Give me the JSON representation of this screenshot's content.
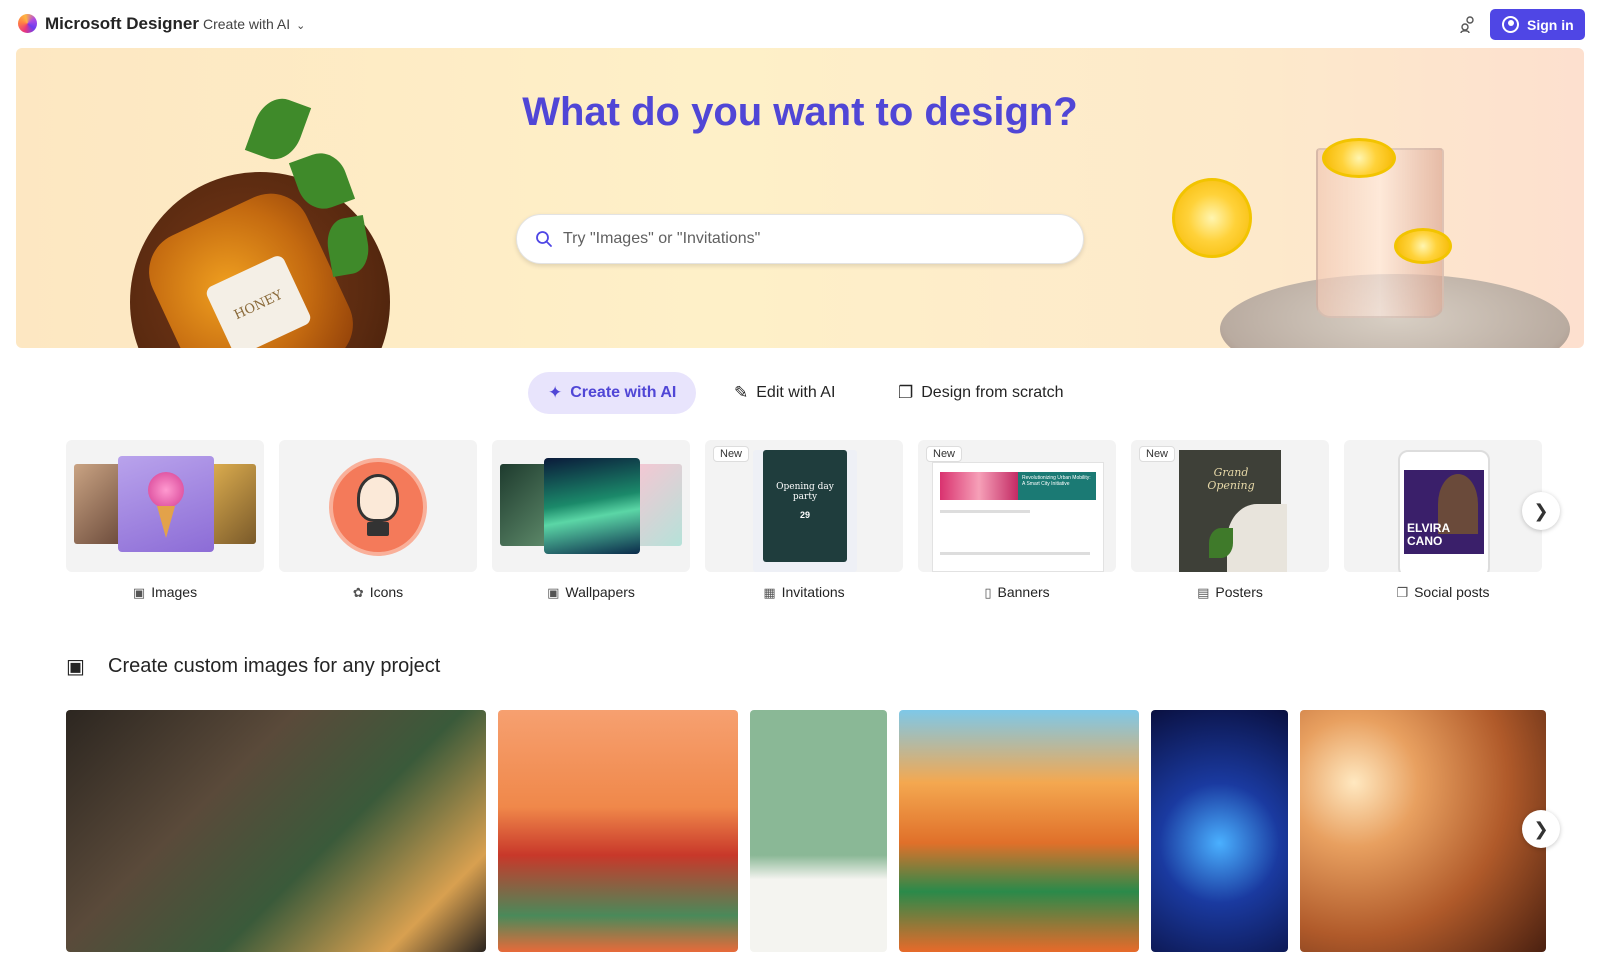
{
  "header": {
    "brand": "Microsoft Designer",
    "create_menu_label": "Create with AI",
    "sign_in_label": "Sign in",
    "accent_color": "#4f46e5"
  },
  "hero": {
    "title": "What do you want to design?",
    "search_placeholder": "Try \"Images\" or \"Invitations\"",
    "honey_label": "HONEY"
  },
  "modes": [
    {
      "label": "Create with AI",
      "active": true
    },
    {
      "label": "Edit with AI",
      "active": false
    },
    {
      "label": "Design from scratch",
      "active": false
    }
  ],
  "categories": [
    {
      "label": "Images",
      "badge": ""
    },
    {
      "label": "Icons",
      "badge": ""
    },
    {
      "label": "Wallpapers",
      "badge": ""
    },
    {
      "label": "Invitations",
      "badge": "New"
    },
    {
      "label": "Banners",
      "badge": "New"
    },
    {
      "label": "Posters",
      "badge": "New"
    },
    {
      "label": "Social posts",
      "badge": ""
    }
  ],
  "card_text": {
    "invitation_title": "Opening day party",
    "invitation_date": "29",
    "banner_title": "Revolutionizing Urban Mobility: A Smart City Initiative",
    "poster_title": "Grand Opening",
    "social_name": "ELVIRA CANO"
  },
  "section": {
    "title": "Create custom images for any project"
  }
}
